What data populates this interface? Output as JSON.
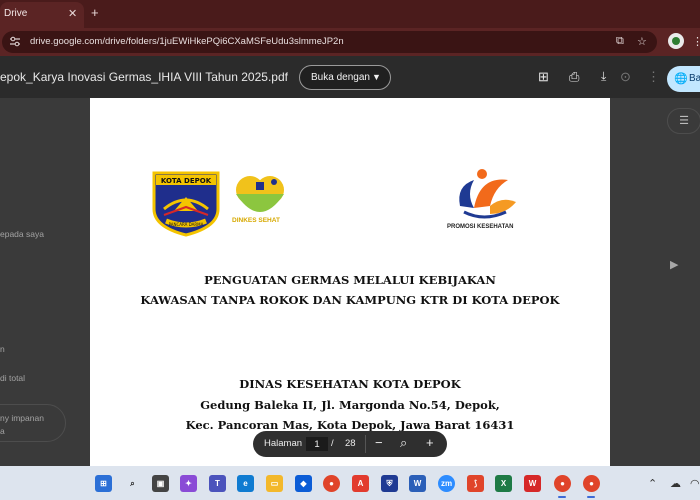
{
  "browser": {
    "tab_title": "Drive",
    "tab_close": "✕",
    "new_tab": "+",
    "url": "drive.google.com/drive/folders/1juEWiHkePQi6CXaMSFeUdu3slmmeJP2n"
  },
  "viewer": {
    "file_name": "epok_Karya Inovasi Germas_IHIA VIII Tahun 2025.pdf",
    "open_with_label": "Buka dengan",
    "share_label": "Ba"
  },
  "sidebar_fragments": {
    "shared_with_me": "epada saya",
    "item_n": "n",
    "storage": "di total",
    "upgrade": "ny impanan",
    "upgrade2": "a"
  },
  "document": {
    "logo_kota_text": "KOTA DEPOK",
    "logo_kota_motto": "PANCARA DARMA",
    "logo_dinkes_text": "DINKES SEHAT",
    "logo_promkes_text": "PROMOSI KESEHATAN",
    "title_line1": "PENGUATAN GERMAS MELALUI KEBIJAKAN",
    "title_line2": "KAWASAN TANPA ROKOK DAN KAMPUNG KTR DI KOTA DEPOK",
    "org_line1": "DINAS KESEHATAN KOTA DEPOK",
    "org_line2": "Gedung Baleka II, Jl. Margonda No.54, Depok,",
    "org_line3": "Kec. Pancoran Mas, Kota Depok, Jawa Barat 16431"
  },
  "pager": {
    "label": "Halaman",
    "current_page": "1",
    "separator": "/",
    "total_pages": "28",
    "zoom_out": "−",
    "zoom_in": "+"
  },
  "colors": {
    "chrome_tab_bar": "#4a1b1b",
    "chrome_toolbar": "#5b2424",
    "share_button": "#c2e7ff",
    "taskbar": "#dde4ee"
  }
}
